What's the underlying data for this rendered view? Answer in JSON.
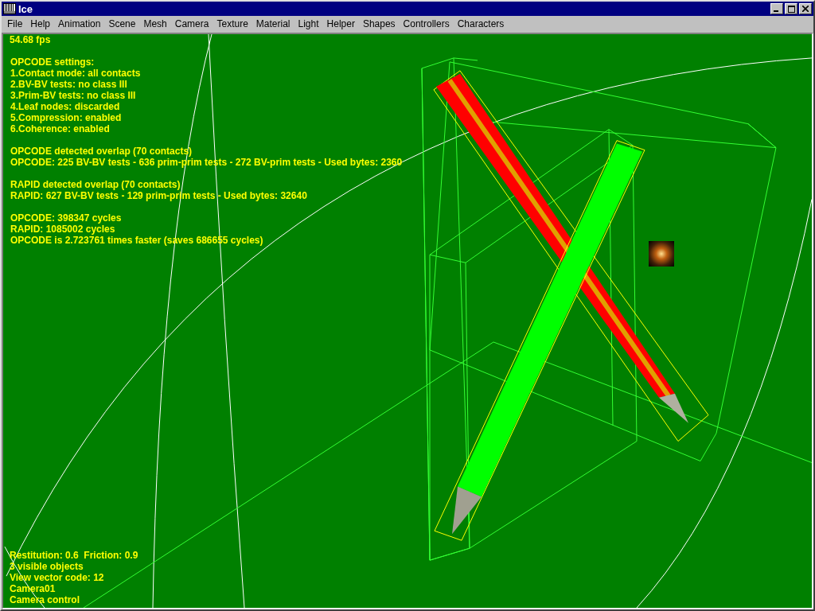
{
  "window": {
    "title": "Ice"
  },
  "menu": [
    "File",
    "Help",
    "Animation",
    "Scene",
    "Mesh",
    "Camera",
    "Texture",
    "Material",
    "Light",
    "Helper",
    "Shapes",
    "Controllers",
    "Characters"
  ],
  "overlay_top": [
    [
      "54.68 fps"
    ],
    [
      "OPCODE settings:",
      "1.Contact mode: all contacts",
      "2.BV-BV tests: no class III",
      "3.Prim-BV tests: no class III",
      "4.Leaf nodes: discarded",
      "5.Compression: enabled",
      "6.Coherence: enabled"
    ],
    [
      "OPCODE detected overlap (70 contacts)",
      "OPCODE: 225 BV-BV tests - 636 prim-prim tests - 272 BV-prim tests - Used bytes: 2360"
    ],
    [
      "RAPID detected overlap (70 contacts)",
      "RAPID: 627 BV-BV tests - 129 prim-prim tests - Used bytes: 32640"
    ],
    [
      "OPCODE: 398347 cycles",
      "RAPID: 1085002 cycles",
      "OPCODE is 2.723761 times faster (saves 686655 cycles)"
    ]
  ],
  "overlay_bottom": [
    "Restitution: 0.6  Friction: 0.9",
    "3 visible objects",
    "View vector code: 12",
    "Camera01",
    "Camera control"
  ]
}
